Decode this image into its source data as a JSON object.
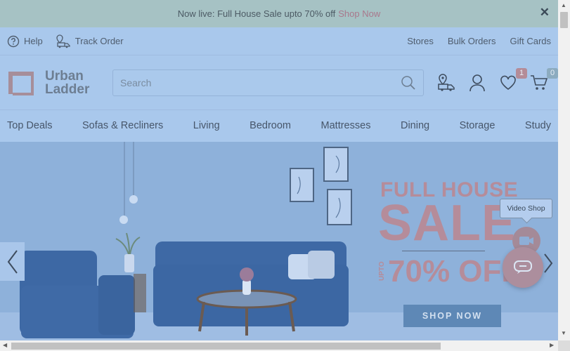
{
  "announcement": {
    "text": "Now live: Full House Sale upto 70% off",
    "link": "Shop Now",
    "close": "✕"
  },
  "utility": {
    "help": "Help",
    "track_order": "Track Order",
    "stores": "Stores",
    "bulk_orders": "Bulk Orders",
    "gift_cards": "Gift Cards"
  },
  "header": {
    "logo_line1": "Urban",
    "logo_line2": "Ladder",
    "search_placeholder": "Search",
    "wishlist_count": "1",
    "cart_count": "0"
  },
  "nav": {
    "items": [
      "Top Deals",
      "Sofas & Recliners",
      "Living",
      "Bedroom",
      "Mattresses",
      "Dining",
      "Storage",
      "Study"
    ]
  },
  "hero": {
    "headline1": "FULL HOUSE",
    "headline2": "SALE",
    "upto": "UPTO",
    "discount": "70% OFF",
    "cta": "SHOP NOW"
  },
  "widgets": {
    "video_tip": "Video Shop"
  },
  "colors": {
    "accent": "#b58c9a",
    "overlay": "#a9c8ec"
  }
}
